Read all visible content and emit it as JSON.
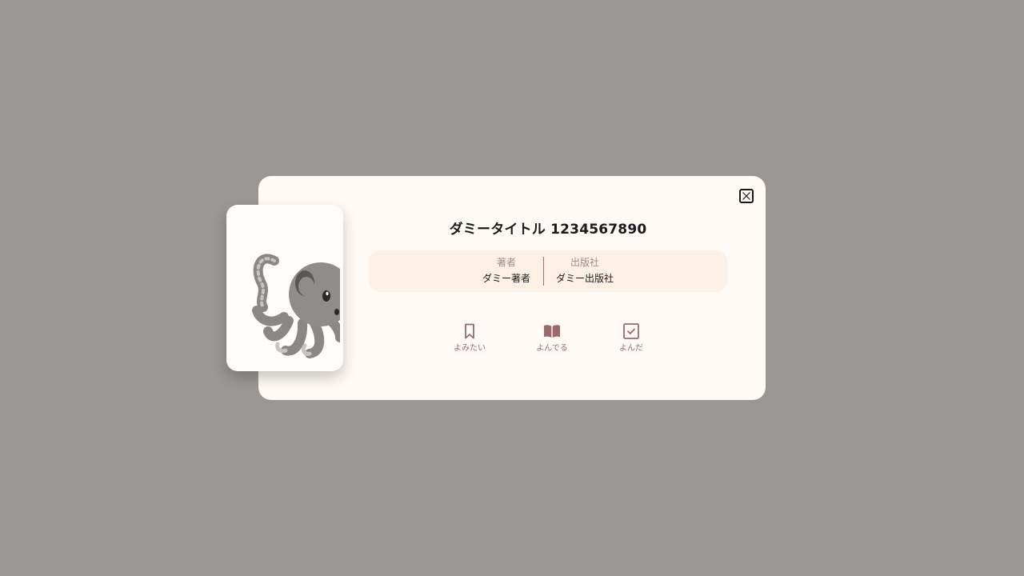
{
  "book": {
    "title": "ダミータイトル 1234567890",
    "author_label": "著者",
    "author": "ダミー著者",
    "publisher_label": "出版社",
    "publisher": "ダミー出版社",
    "cover_icon": "octopus-icon"
  },
  "actions": [
    {
      "label": "よみたい",
      "icon": "bookmark-icon"
    },
    {
      "label": "よんでる",
      "icon": "open-book-icon"
    },
    {
      "label": "よんだ",
      "icon": "checkbox-icon"
    }
  ],
  "close_icon": "close-icon",
  "colors": {
    "backdrop": "#9b9794",
    "modal_bg": "#fffaf5",
    "info_bg": "#fff0e6",
    "accent": "#9a6b6b"
  }
}
